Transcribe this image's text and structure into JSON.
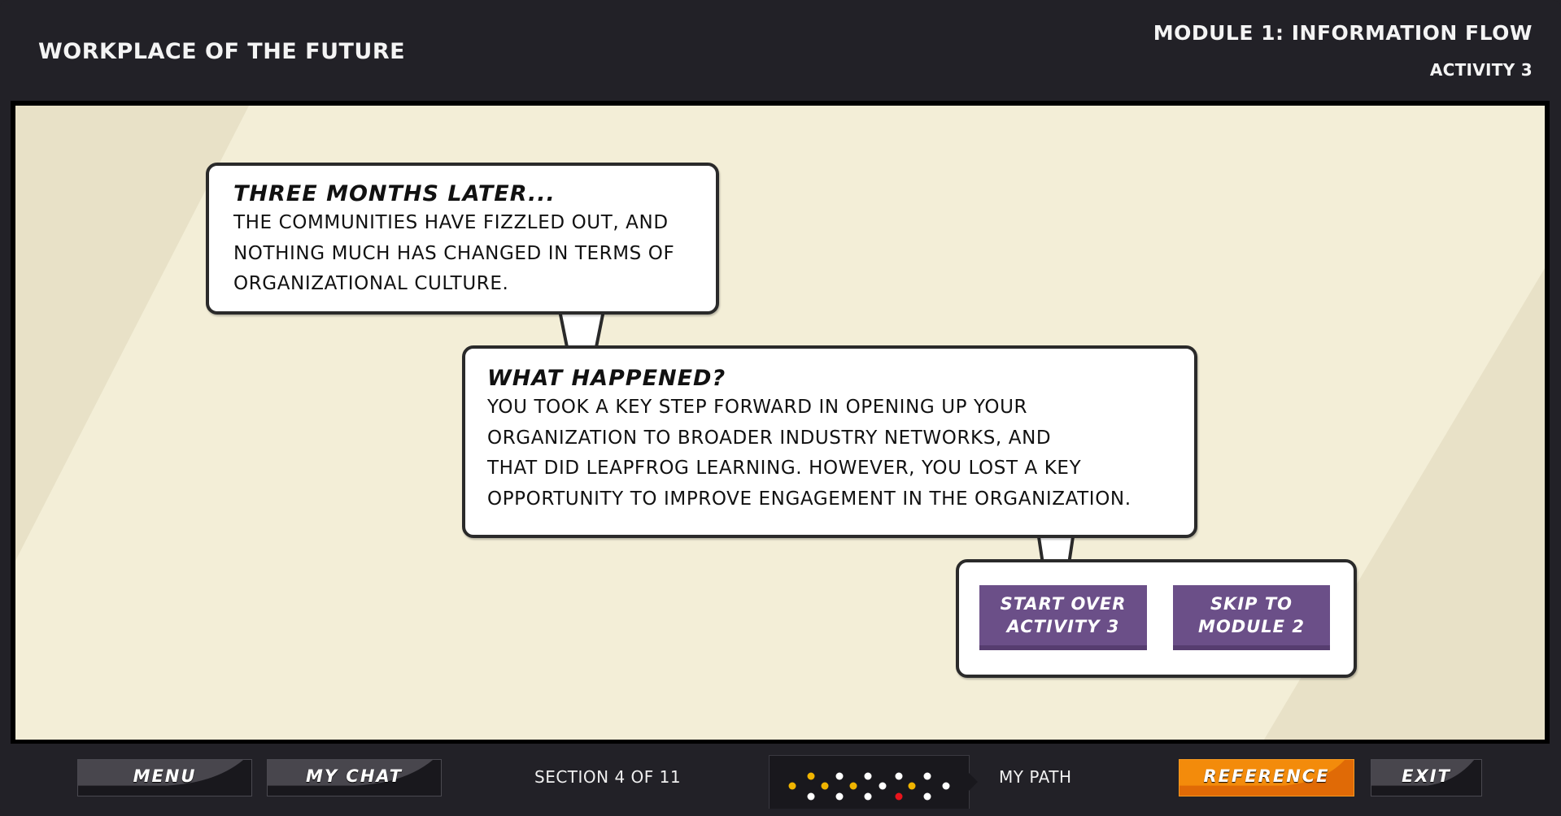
{
  "header": {
    "app_title": "WORKPLACE OF THE FUTURE",
    "module_title": "MODULE 1: INFORMATION FLOW",
    "activity_title": "ACTIVITY 3"
  },
  "scene": {
    "bubble1": {
      "heading": "THREE MONTHS LATER...",
      "lines": [
        "THE COMMUNITIES HAVE FIZZLED OUT, AND",
        "NOTHING MUCH HAS CHANGED IN TERMS OF",
        "ORGANIZATIONAL CULTURE."
      ]
    },
    "bubble2": {
      "heading": "WHAT HAPPENED?",
      "lines": [
        "YOU TOOK A KEY STEP FORWARD IN OPENING UP YOUR",
        "ORGANIZATION TO BROADER INDUSTRY NETWORKS, AND",
        "THAT DID LEAPFROG LEARNING. HOWEVER, YOU LOST A KEY",
        "OPPORTUNITY TO IMPROVE ENGAGEMENT IN THE ORGANIZATION."
      ]
    },
    "actions": {
      "start_over": {
        "line1": "START OVER",
        "line2": "ACTIVITY 3"
      },
      "skip": {
        "line1": "SKIP TO",
        "line2": "MODULE 2"
      }
    }
  },
  "footer": {
    "menu_label": "MENU",
    "chat_label": "MY CHAT",
    "section_text": "SECTION 4 OF 11",
    "path_label": "MY PATH",
    "reference_label": "REFERENCE",
    "exit_label": "EXIT",
    "path_dots": [
      {
        "col": 1,
        "row": "middle",
        "state": "visited"
      },
      {
        "col": 2,
        "row": "top",
        "state": "visited"
      },
      {
        "col": 2,
        "row": "bottom",
        "state": "unvisited"
      },
      {
        "col": 3,
        "row": "middle",
        "state": "visited"
      },
      {
        "col": 4,
        "row": "top",
        "state": "unvisited"
      },
      {
        "col": 4,
        "row": "bottom",
        "state": "unvisited"
      },
      {
        "col": 5,
        "row": "middle",
        "state": "visited"
      },
      {
        "col": 6,
        "row": "top",
        "state": "unvisited"
      },
      {
        "col": 6,
        "row": "bottom",
        "state": "unvisited"
      },
      {
        "col": 7,
        "row": "middle",
        "state": "unvisited"
      },
      {
        "col": 8,
        "row": "top",
        "state": "unvisited"
      },
      {
        "col": 8,
        "row": "bottom",
        "state": "current"
      },
      {
        "col": 9,
        "row": "middle",
        "state": "visited"
      },
      {
        "col": 10,
        "row": "top",
        "state": "unvisited"
      },
      {
        "col": 10,
        "row": "bottom",
        "state": "unvisited"
      },
      {
        "col": 11,
        "row": "middle",
        "state": "unvisited"
      }
    ]
  },
  "colors": {
    "chrome": "#222127",
    "panel_bg": "#f3eed7",
    "panel_stripe": "#e8e1c7",
    "action_purple": "#6b4f88",
    "reference_orange": "#f08a0a",
    "dot_visited": "#f0b400",
    "dot_unvisited": "#ffffff",
    "dot_current": "#e8141c"
  }
}
